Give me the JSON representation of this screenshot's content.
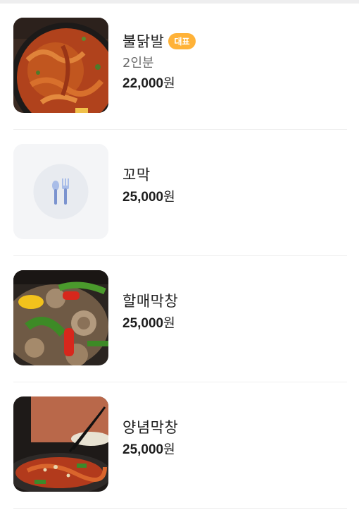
{
  "menu": {
    "items": [
      {
        "name": "불닭발",
        "badge": "대표",
        "portion": "2인분",
        "price": "22,000",
        "currency": "원",
        "image": "dakbal-photo"
      },
      {
        "name": "꼬막",
        "price": "25,000",
        "currency": "원",
        "image": "fork-spoon-icon"
      },
      {
        "name": "할매막창",
        "price": "25,000",
        "currency": "원",
        "image": "makchang-photo"
      },
      {
        "name": "양념막창",
        "price": "25,000",
        "currency": "원",
        "image": "yangnyeom-makchang-photo"
      }
    ]
  },
  "colors": {
    "badge": "#ffb238",
    "divider": "#efefef",
    "placeholder_bg": "#f4f5f7",
    "placeholder_icon": "#8ba2d8"
  }
}
